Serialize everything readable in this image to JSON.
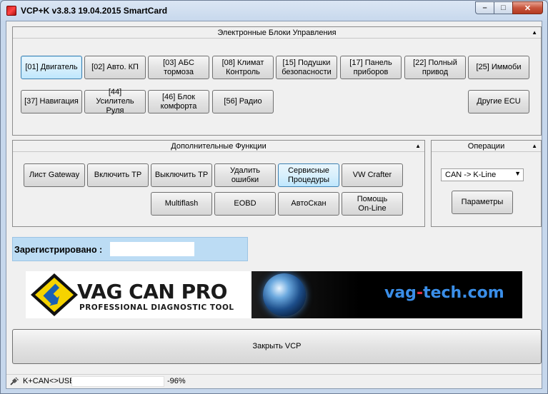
{
  "window": {
    "title": "VCP+K v3.8.3 19.04.2015 SmartCard",
    "minimize": "–",
    "maximize": "□",
    "close": "✕"
  },
  "ecu_panel": {
    "title": "Электронные Блоки Управления",
    "buttons": [
      "[01] Двигатель",
      "[02] Авто. КП",
      "[03] АБС тормоза",
      "[08] Климат Контроль",
      "[15] Подушки безопасности",
      "[17] Панель приборов",
      "[22] Полный привод",
      "[25] Иммоби",
      "[37] Навигация",
      "[44] Усилитель Руля",
      "[46] Блок комфорта",
      "[56] Радио",
      "Другие ECU"
    ]
  },
  "functions_panel": {
    "title": "Дополнительные Функции",
    "buttons": [
      "Лист Gateway",
      "Включить ТР",
      "Выключить ТР",
      "Удалить ошибки",
      "Сервисные Процедуры",
      "VW Crafter",
      "Multiflash",
      "EOBD",
      "АвтоСкан",
      "Помощь On-Line"
    ]
  },
  "operations_panel": {
    "title": "Операции",
    "select_value": "CAN -> K-Line",
    "params_button": "Параметры"
  },
  "registration": {
    "label": "Зарегистрировано :",
    "value": ""
  },
  "banner": {
    "logo_title": "VAG CAN PRO",
    "logo_subtitle": "PROFESSIONAL DIAGNOSTIC TOOL",
    "site_part1": "vag",
    "site_part2": "-",
    "site_part3": "tech.com"
  },
  "close_button": "Закрыть VCP",
  "status": {
    "connection": "K+CAN<>USB",
    "progress_percent": "-96%"
  },
  "colors": {
    "accent": "#3c7fb1",
    "logo_yellow": "#f5d300",
    "site_blue": "#3a8ee8",
    "site_red": "#e03040"
  }
}
